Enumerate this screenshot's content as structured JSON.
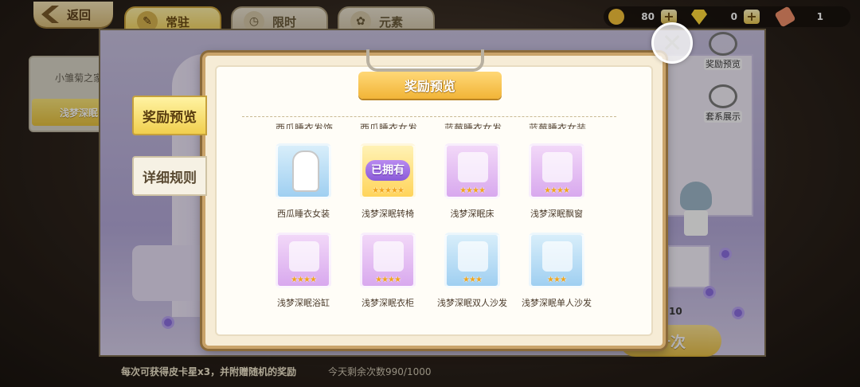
{
  "nav": {
    "back_label": "返回"
  },
  "tabs": [
    {
      "label": "常驻",
      "icon": "tag-icon"
    },
    {
      "label": "限时",
      "icon": "clock-icon"
    },
    {
      "label": "元素",
      "icon": "flower-icon"
    }
  ],
  "currency": [
    {
      "icon": "coin-icon",
      "value": "80",
      "color": "#f5c23a"
    },
    {
      "icon": "diamond-icon",
      "value": "0",
      "color": "#ffd93a"
    },
    {
      "icon": "ticket-icon",
      "value": "1",
      "color": "#f08f6a"
    }
  ],
  "left_panel": {
    "items": [
      "小雏菊之家",
      "浅梦深眠"
    ],
    "selected": "浅梦深眠"
  },
  "side_tabs": [
    "奖励预览",
    "详细规则"
  ],
  "tools": [
    "奖励预览",
    "套系展示"
  ],
  "modal": {
    "title": "奖励预览",
    "cut_labels": [
      "西瓜睡衣发饰",
      "西瓜睡衣女发",
      "蓝莓睡衣女发",
      "蓝莓睡衣女装"
    ],
    "rewards": [
      {
        "name": "西瓜睡衣女装",
        "stars": 0,
        "tile": "blue",
        "owned": false
      },
      {
        "name": "浅梦深眠转椅",
        "stars": 5,
        "tile": "gold",
        "owned": true,
        "owned_label": "已拥有"
      },
      {
        "name": "浅梦深眠床",
        "stars": 4,
        "tile": "purple",
        "owned": false
      },
      {
        "name": "浅梦深眠飘窗",
        "stars": 4,
        "tile": "purple",
        "owned": false
      },
      {
        "name": "浅梦深眠浴缸",
        "stars": 4,
        "tile": "purple",
        "owned": false
      },
      {
        "name": "浅梦深眠衣柜",
        "stars": 4,
        "tile": "purple",
        "owned": false
      },
      {
        "name": "浅梦深眠双人沙发",
        "stars": 3,
        "tile": "blue",
        "owned": false
      },
      {
        "name": "浅梦深眠单人沙发",
        "stars": 3,
        "tile": "blue",
        "owned": false
      }
    ]
  },
  "footer": {
    "info": "每次可获得皮卡星x3，并附赠随机的奖励",
    "remaining": "今天剩余次数990/1000",
    "draw_label": "十次",
    "count": "10"
  }
}
